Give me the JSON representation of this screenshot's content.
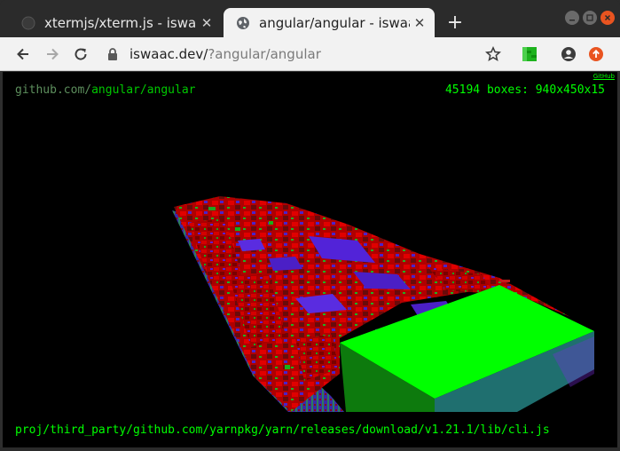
{
  "tabs": [
    {
      "title": "xtermjs/xterm.js - iswaac",
      "active": false
    },
    {
      "title": "angular/angular - iswaac",
      "active": true
    }
  ],
  "toolbar": {
    "url_host": "iswaac.dev/",
    "url_path": "?angular/angular"
  },
  "page": {
    "github_link": "GitHub",
    "repo_prefix": "github.com/",
    "repo_name": "angular/angular",
    "stats": "45194 boxes: 940x450x15",
    "file_path": "proj/third_party/github.com/yarnpkg/yarn/releases/download/v1.21.1/lib/cli.js"
  },
  "colors": {
    "terminal_green": "#00ff00",
    "box_red": "#b00000",
    "box_blue": "#5a1fd6",
    "box_green": "#00ff00",
    "teal_side": "#1f6f6f",
    "update_badge": "#e95420"
  }
}
